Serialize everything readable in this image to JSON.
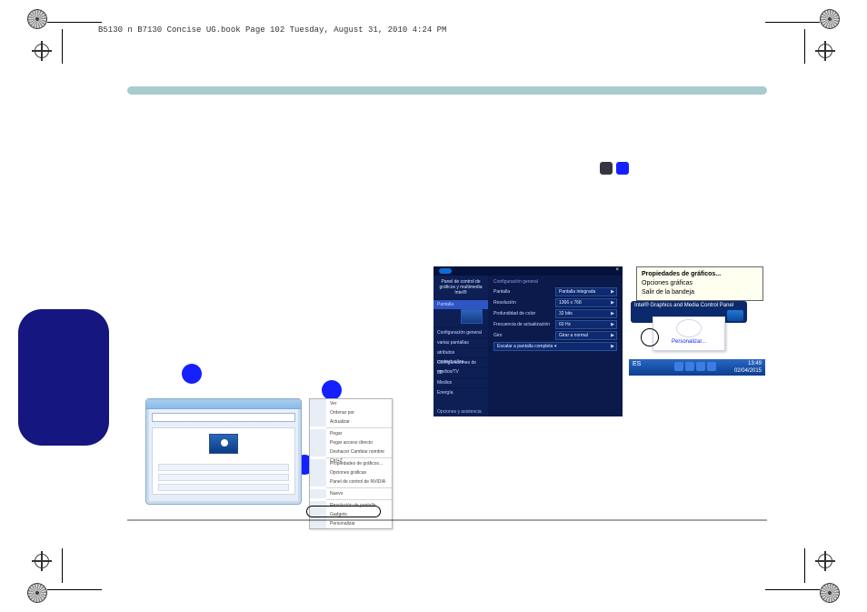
{
  "header_line": "B5130 n B7130 Concise UG.book  Page 102  Tuesday, August 31, 2010  4:24 PM",
  "context_menu": {
    "items": [
      "Ver",
      "Ordenar por",
      "Actualizar",
      "Pegar",
      "Pegar acceso directo",
      "Deshacer Cambiar nombre   Ctrl+Z",
      "Propiedades de gráficos...",
      "Opciones gráficas",
      "Panel de control de NVIDIA",
      "Nuevo",
      "Resolución de pantalla",
      "Gadgets",
      "Personalizar"
    ],
    "highlight": "Resolución de pantalla"
  },
  "intel": {
    "title": "Panel de control de gráficos y multimedia Intel®",
    "group": "Configuración general",
    "side": {
      "selected": "Pantalla",
      "items": [
        "Configuración general",
        "varias pantallas",
        "atributos contextualiza...",
        "Configuraciones de medios/TV"
      ],
      "sections": [
        "3D",
        "Medios",
        "Energía"
      ],
      "footer": "Opciones y asistencia"
    },
    "rows": [
      {
        "label": "Pantalla",
        "value": "Pantalla integrada"
      },
      {
        "label": "Resolución",
        "value": "1366 x 768"
      },
      {
        "label": "Profundidad de color",
        "value": "32 bits"
      },
      {
        "label": "Frecuencia de actualización",
        "value": "60 Hz"
      },
      {
        "label": "Giro",
        "value": "Girar a normal"
      }
    ],
    "wide_row": "Escalar a pantalla completa ▾"
  },
  "tray": {
    "tooltip": [
      "Propiedades de gráficos...",
      "Opciones gráficas",
      "Salir de la bandeja"
    ],
    "toast": "Intel® Graphics and Media Control Panel",
    "card": "Personalizar...",
    "lang": "ES",
    "clock": {
      "time": "13:49",
      "date": "02/04/2015"
    }
  }
}
